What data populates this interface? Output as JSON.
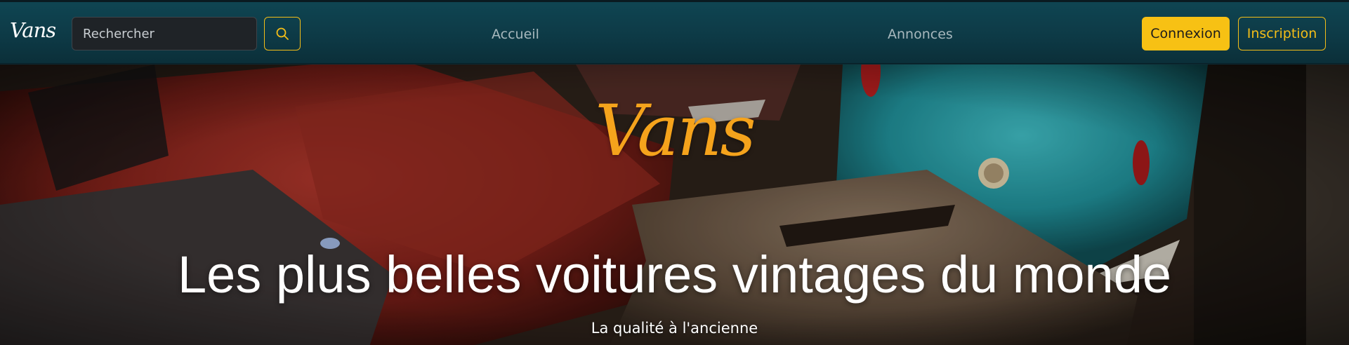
{
  "navbar": {
    "brand": "Vans",
    "search": {
      "placeholder": "Rechercher",
      "button_icon": "search-icon"
    },
    "links": {
      "home": "Accueil",
      "ads": "Annonces"
    },
    "login_label": "Connexion",
    "signup_label": "Inscription"
  },
  "hero": {
    "logo": "Vans",
    "title": "Les plus belles voitures vintages du monde",
    "subtitle": "La qualité à l'ancienne"
  },
  "colors": {
    "navbar": "#0e3f4b",
    "accent": "#f7c114",
    "hero_logo": "#f5a31c"
  }
}
